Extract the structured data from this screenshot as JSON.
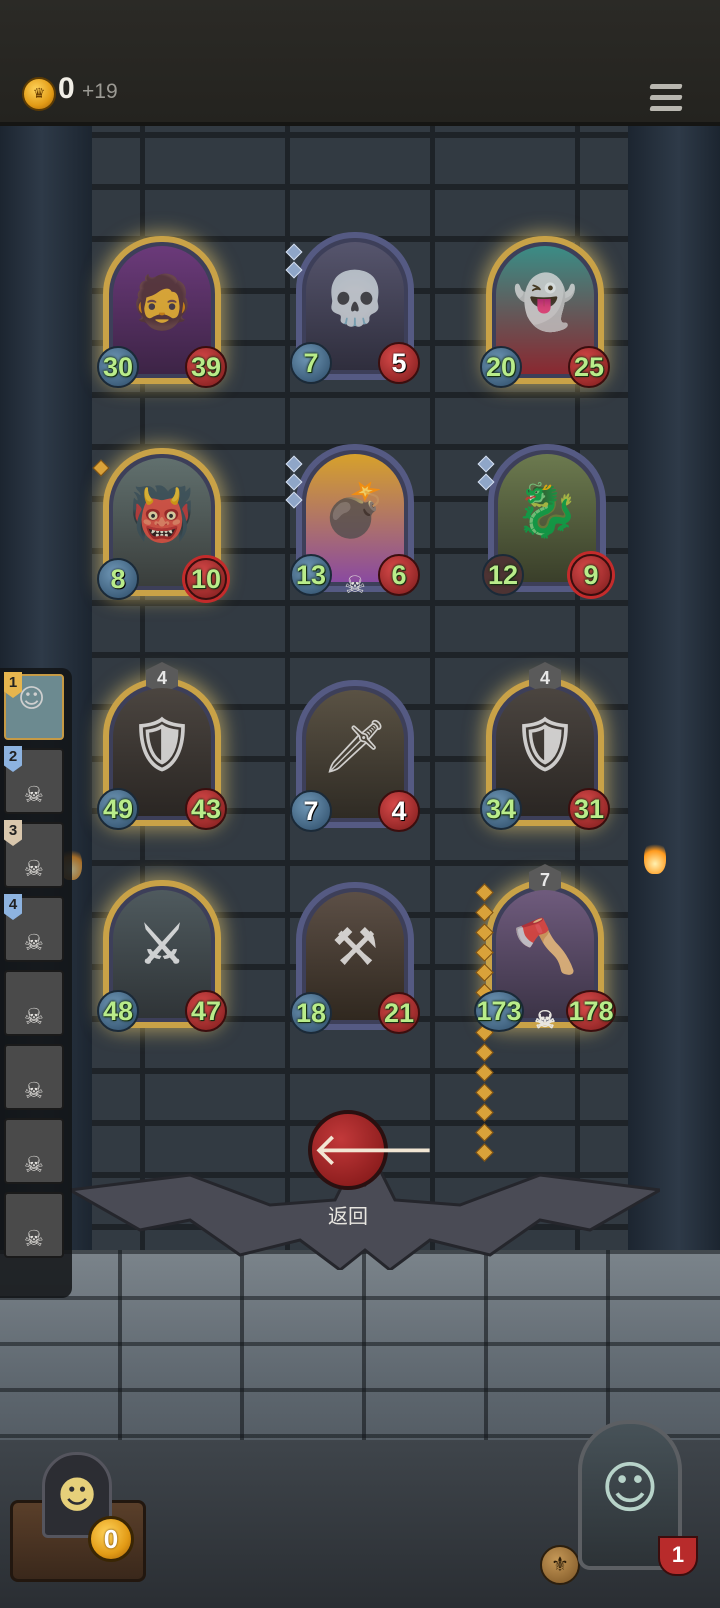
{
  "header": {
    "gold": "0",
    "income": "+19",
    "coin_icon": "crown-coin-icon",
    "menu_icon": "menu-icon"
  },
  "board": [
    {
      "id": "card-1",
      "atk": "30",
      "hp": "39",
      "frame": "gold",
      "icon": "old-man-axe"
    },
    {
      "id": "card-2",
      "atk": "7",
      "hp": "5",
      "frame": "plain",
      "icon": "skull-mask-rogue"
    },
    {
      "id": "card-3",
      "atk": "20",
      "hp": "25",
      "frame": "gold",
      "icon": "green-ghost"
    },
    {
      "id": "card-4",
      "atk": "8",
      "hp": "10",
      "frame": "gold",
      "icon": "horned-beast"
    },
    {
      "id": "card-5",
      "atk": "13",
      "hp": "6",
      "frame": "plain",
      "icon": "hooded-bomber"
    },
    {
      "id": "card-6",
      "atk": "12",
      "hp": "9",
      "frame": "plain",
      "icon": "purple-dragon"
    },
    {
      "id": "card-7",
      "atk": "49",
      "hp": "43",
      "frame": "gold",
      "icon": "shield-knight",
      "tier": "4"
    },
    {
      "id": "card-8",
      "atk": "7",
      "hp": "4",
      "frame": "plain",
      "icon": "hooded-thief"
    },
    {
      "id": "card-9",
      "atk": "34",
      "hp": "31",
      "frame": "gold",
      "icon": "shield-knight",
      "tier": "4"
    },
    {
      "id": "card-10",
      "atk": "48",
      "hp": "47",
      "frame": "gold",
      "icon": "plumed-knight"
    },
    {
      "id": "card-11",
      "atk": "18",
      "hp": "21",
      "frame": "plain",
      "icon": "blacksmith-girl"
    },
    {
      "id": "card-12",
      "atk": "173",
      "hp": "178",
      "frame": "gold",
      "icon": "bandit-warrior",
      "tier": "7"
    }
  ],
  "opponents": [
    {
      "rank": "1"
    },
    {
      "rank": "2"
    },
    {
      "rank": "3"
    },
    {
      "rank": "4"
    },
    {
      "rank": ""
    },
    {
      "rank": ""
    },
    {
      "rank": ""
    },
    {
      "rank": ""
    }
  ],
  "back": {
    "label": "返回",
    "icon": "arrow-left-icon"
  },
  "player": {
    "coins": "0",
    "level": "1"
  }
}
